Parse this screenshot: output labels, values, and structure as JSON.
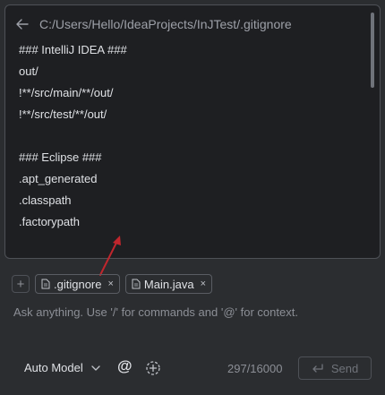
{
  "preview": {
    "path": "C:/Users/Hello/IdeaProjects/InJTest/.gitignore",
    "lines": [
      "### IntelliJ IDEA ###",
      "out/",
      "!**/src/main/**/out/",
      "!**/src/test/**/out/",
      "",
      "### Eclipse ###",
      ".apt_generated",
      ".classpath",
      ".factorypath"
    ]
  },
  "chips": {
    "add": "+",
    "items": [
      {
        "label": ".gitignore",
        "close": "×"
      },
      {
        "label": "Main.java",
        "close": "×"
      }
    ]
  },
  "input": {
    "placeholder": "Ask anything. Use '/' for commands and '@' for context."
  },
  "bottom": {
    "model": "Auto Model",
    "at": "@",
    "counter": "297/16000",
    "send": "Send"
  },
  "colors": {
    "annotation_arrow": "#c0262d",
    "background": "#2b2d30",
    "preview_background": "#1e1f22"
  }
}
